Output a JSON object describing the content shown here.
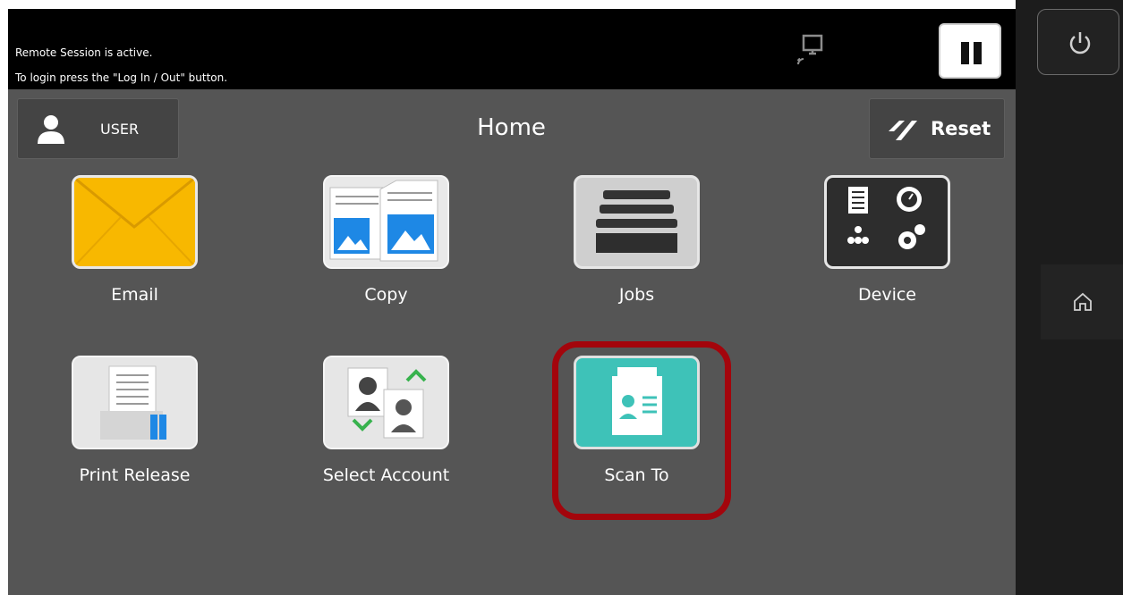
{
  "status": {
    "line1": "Remote Session is active.",
    "line2": "To login press the \"Log In / Out\" button."
  },
  "header": {
    "user_label": "USER",
    "title": "Home",
    "reset_label": "Reset"
  },
  "apps": [
    {
      "label": "Email",
      "icon": "email-envelope-icon"
    },
    {
      "label": "Copy",
      "icon": "copy-icon"
    },
    {
      "label": "Jobs",
      "icon": "jobs-drawer-icon"
    },
    {
      "label": "Device",
      "icon": "device-icon"
    },
    {
      "label": "Print Release",
      "icon": "print-release-icon"
    },
    {
      "label": "Select Account",
      "icon": "select-account-icon"
    },
    {
      "label": "Scan To",
      "icon": "scan-to-icon"
    }
  ],
  "side": {
    "power_icon": "power-icon",
    "home_icon": "home-icon"
  },
  "colors": {
    "panel_bg": "#555555",
    "status_bg": "#000000",
    "email_tile": "#f8b800",
    "copy_accent": "#1e88e5",
    "scan_tile": "#3ec2b8",
    "highlight": "#a3050c"
  }
}
